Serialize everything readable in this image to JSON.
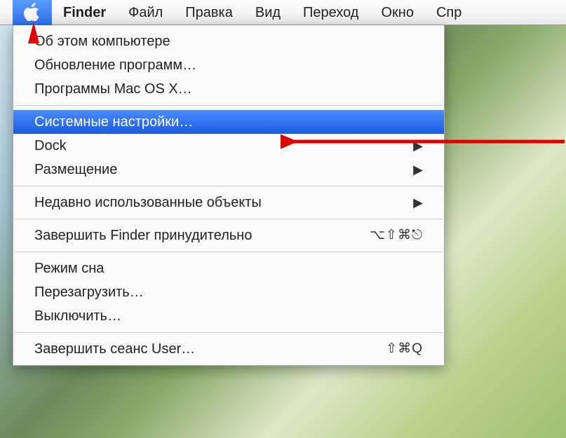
{
  "menubar": {
    "app": "Finder",
    "items": [
      "Файл",
      "Правка",
      "Вид",
      "Переход",
      "Окно",
      "Спр"
    ]
  },
  "apple_menu": {
    "about": "Об этом компьютере",
    "software_update": "Обновление программ…",
    "mac_os_programs": "Программы Mac OS X…",
    "system_preferences": "Системные настройки…",
    "dock": "Dock",
    "location": "Размещение",
    "recent_items": "Недавно использованные объекты",
    "force_quit": "Завершить Finder принудительно",
    "force_quit_shortcut": "⌥⇧⌘⎋",
    "sleep": "Режим сна",
    "restart": "Перезагрузить…",
    "shutdown": "Выключить…",
    "logout": "Завершить сеанс User…",
    "logout_shortcut": "⇧⌘Q"
  }
}
